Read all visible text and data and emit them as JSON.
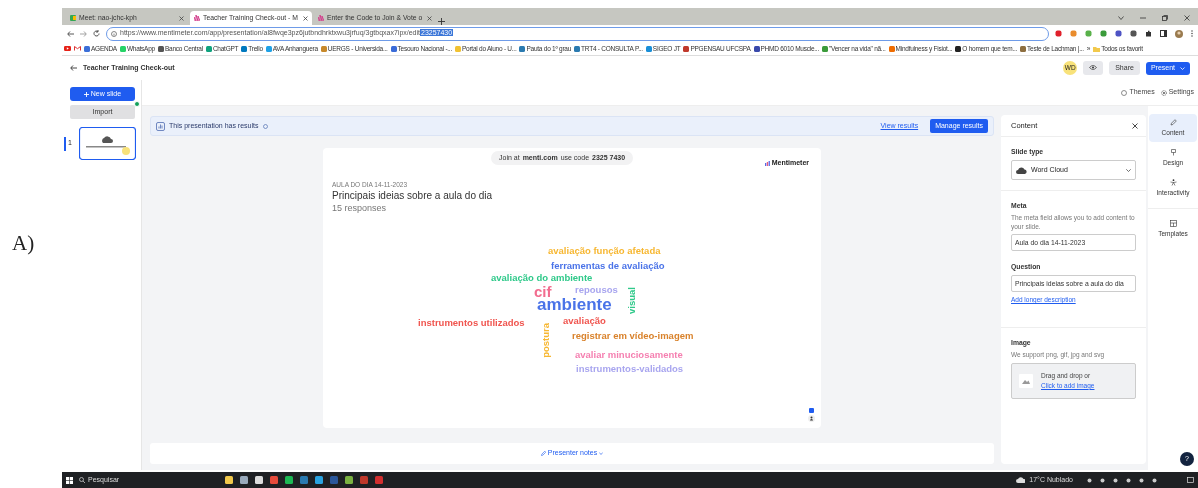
{
  "figure_label": "A)",
  "browser": {
    "tabs": [
      {
        "title": "Meet: nao-jchc-kph",
        "selected": false
      },
      {
        "title": "Teacher Training Check-out - M",
        "selected": true
      },
      {
        "title": "Enter the Code to Join & Vote o",
        "selected": false
      }
    ],
    "url": "https://www.mentimeter.com/app/presentation/al8fwqe3pz6jutbndhrktxwu3jrfuq/3gtbqxax7ipx/edit",
    "url_selected": "23257430",
    "bookmarks": [
      "AGENDA",
      "WhatsApp",
      "Banco Central",
      "ChatGPT",
      "Trello",
      "AVA Anhanguera",
      "UERGS - Universida...",
      "Tesouro Nacional -...",
      "Portal do Aluno - U...",
      "Pauta do 1º grau",
      "TRT4 - CONSULTA P...",
      "SIGEO JT",
      "PPGENSAU UFCSPA",
      "PHMD 6010 Muscle...",
      "\"Vencer na vida\" nã...",
      "Mindfulness y Fisiot...",
      "O homem que tem...",
      "Teste de Lachman |..."
    ],
    "more": "»",
    "all_bookmarks": "Todos os favorit"
  },
  "header": {
    "title": "Teacher Training Check-out",
    "avatar": "WD",
    "share": "Share",
    "present": "Present"
  },
  "toolbar": {
    "themes": "Themes",
    "settings": "Settings"
  },
  "sidebar": {
    "new_slide": "New slide",
    "import": "Import",
    "slides": [
      {
        "number": "1",
        "selected": true
      }
    ]
  },
  "banner": {
    "text": "This presentation has results",
    "view": "View results",
    "manage": "Manage results"
  },
  "slide": {
    "join_prefix": "Join at",
    "join_site": "menti.com",
    "join_mid": "use code",
    "code": "2325 7430",
    "brand": "Mentimeter",
    "meta": "AULA DO DIA 14-11-2023",
    "question": "Principais ideias sobre a aula do dia",
    "responses": "15 responses",
    "words": [
      {
        "text": "avaliação função afetada",
        "color": "#f7b731",
        "kind": "horizontal"
      },
      {
        "text": "ferramentas de avaliação",
        "color": "#4a73e8",
        "kind": "horizontal"
      },
      {
        "text": "avaliação do ambiente",
        "color": "#2fc98a",
        "kind": "horizontal"
      },
      {
        "text": "cif",
        "color": "#f26d8f",
        "kind": "horizontal"
      },
      {
        "text": "repousos",
        "color": "#a8a5ef",
        "kind": "horizontal"
      },
      {
        "text": "visual",
        "color": "#2fc98a",
        "kind": "vertical"
      },
      {
        "text": "ambiente",
        "color": "#4a73e8",
        "kind": "horizontal"
      },
      {
        "text": "instrumentos utilizados",
        "color": "#f0554f",
        "kind": "horizontal"
      },
      {
        "text": "avaliação",
        "color": "#f0554f",
        "kind": "horizontal"
      },
      {
        "text": "postura",
        "color": "#f7b731",
        "kind": "vertical"
      },
      {
        "text": "registrar em vídeo-imagem",
        "color": "#d9822b",
        "kind": "horizontal"
      },
      {
        "text": "avaliar minuciosamente",
        "color": "#f57fb0",
        "kind": "horizontal"
      },
      {
        "text": "instrumentos-validados",
        "color": "#a8a5ef",
        "kind": "horizontal"
      }
    ]
  },
  "presenter_notes": "Presenter notes",
  "panel": {
    "title": "Content",
    "slide_type_label": "Slide type",
    "slide_type": "Word Cloud",
    "meta_label": "Meta",
    "meta_help": "The meta field allows you to add content to your slide.",
    "meta_value": "Aula do dia 14-11-2023",
    "question_label": "Question",
    "question_value": "Principais ideias sobre a aula do dia",
    "add_description": "Add longer description",
    "image_label": "Image",
    "image_help": "We support png, gif, jpg and svg",
    "drop_text": "Drag and drop or",
    "drop_link": "Click to add image"
  },
  "rail": [
    {
      "label": "Content",
      "selected": true
    },
    {
      "label": "Design",
      "selected": false
    },
    {
      "label": "Interactivity",
      "selected": false
    },
    {
      "label": "Templates",
      "selected": false
    }
  ],
  "help": "?",
  "taskbar": {
    "search": "Pesquisar",
    "weather": "17°C Nublado"
  }
}
